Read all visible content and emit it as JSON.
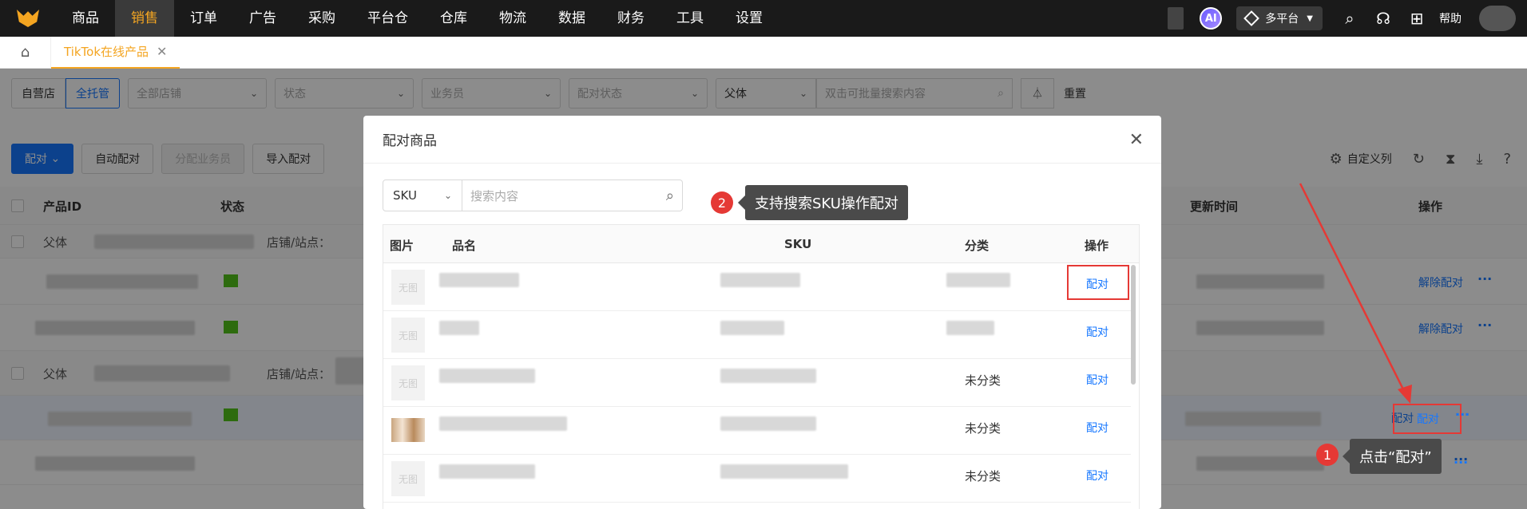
{
  "nav": {
    "items": [
      "商品",
      "销售",
      "订单",
      "广告",
      "采购",
      "平台仓",
      "仓库",
      "物流",
      "数据",
      "财务",
      "工具",
      "设置"
    ],
    "active_index": 1,
    "ai_label": "AI",
    "platform_label": "多平台",
    "help_label": "帮助"
  },
  "tabs": {
    "active_tab": "TikTok在线产品"
  },
  "filters": {
    "self_store": "自营店",
    "full_managed": "全托管",
    "all_stores": "全部店铺",
    "status": "状态",
    "salesperson": "业务员",
    "match_status": "配对状态",
    "parent": "父体",
    "search_placeholder": "双击可批量搜索内容",
    "reset": "重置"
  },
  "toolbar": {
    "match": "配对",
    "auto_match": "自动配对",
    "assign_salesperson": "分配业务员",
    "import_match": "导入配对",
    "custom_columns": "自定义列"
  },
  "table": {
    "headers": {
      "product_id": "产品ID",
      "status": "状态",
      "updated": "更新时间",
      "actions": "操作"
    },
    "parent_label": "父体",
    "store_label": "店铺/站点：",
    "unmatch": "解除配对",
    "match": "配对"
  },
  "modal": {
    "title": "配对商品",
    "search_type": "SKU",
    "search_placeholder": "搜索内容",
    "headers": {
      "image": "图片",
      "name": "品名",
      "sku": "SKU",
      "category": "分类",
      "action": "操作"
    },
    "no_image": "无图",
    "rows": [
      {
        "category": "",
        "action": "配对",
        "has_image": false
      },
      {
        "category": "",
        "action": "配对",
        "has_image": false
      },
      {
        "category": "未分类",
        "action": "配对",
        "has_image": false
      },
      {
        "category": "未分类",
        "action": "配对",
        "has_image": true
      },
      {
        "category": "未分类",
        "action": "配对",
        "has_image": false
      }
    ]
  },
  "callouts": {
    "one_num": "1",
    "one_text": "点击“配对”",
    "two_num": "2",
    "two_text": "支持搜索SKU操作配对"
  }
}
